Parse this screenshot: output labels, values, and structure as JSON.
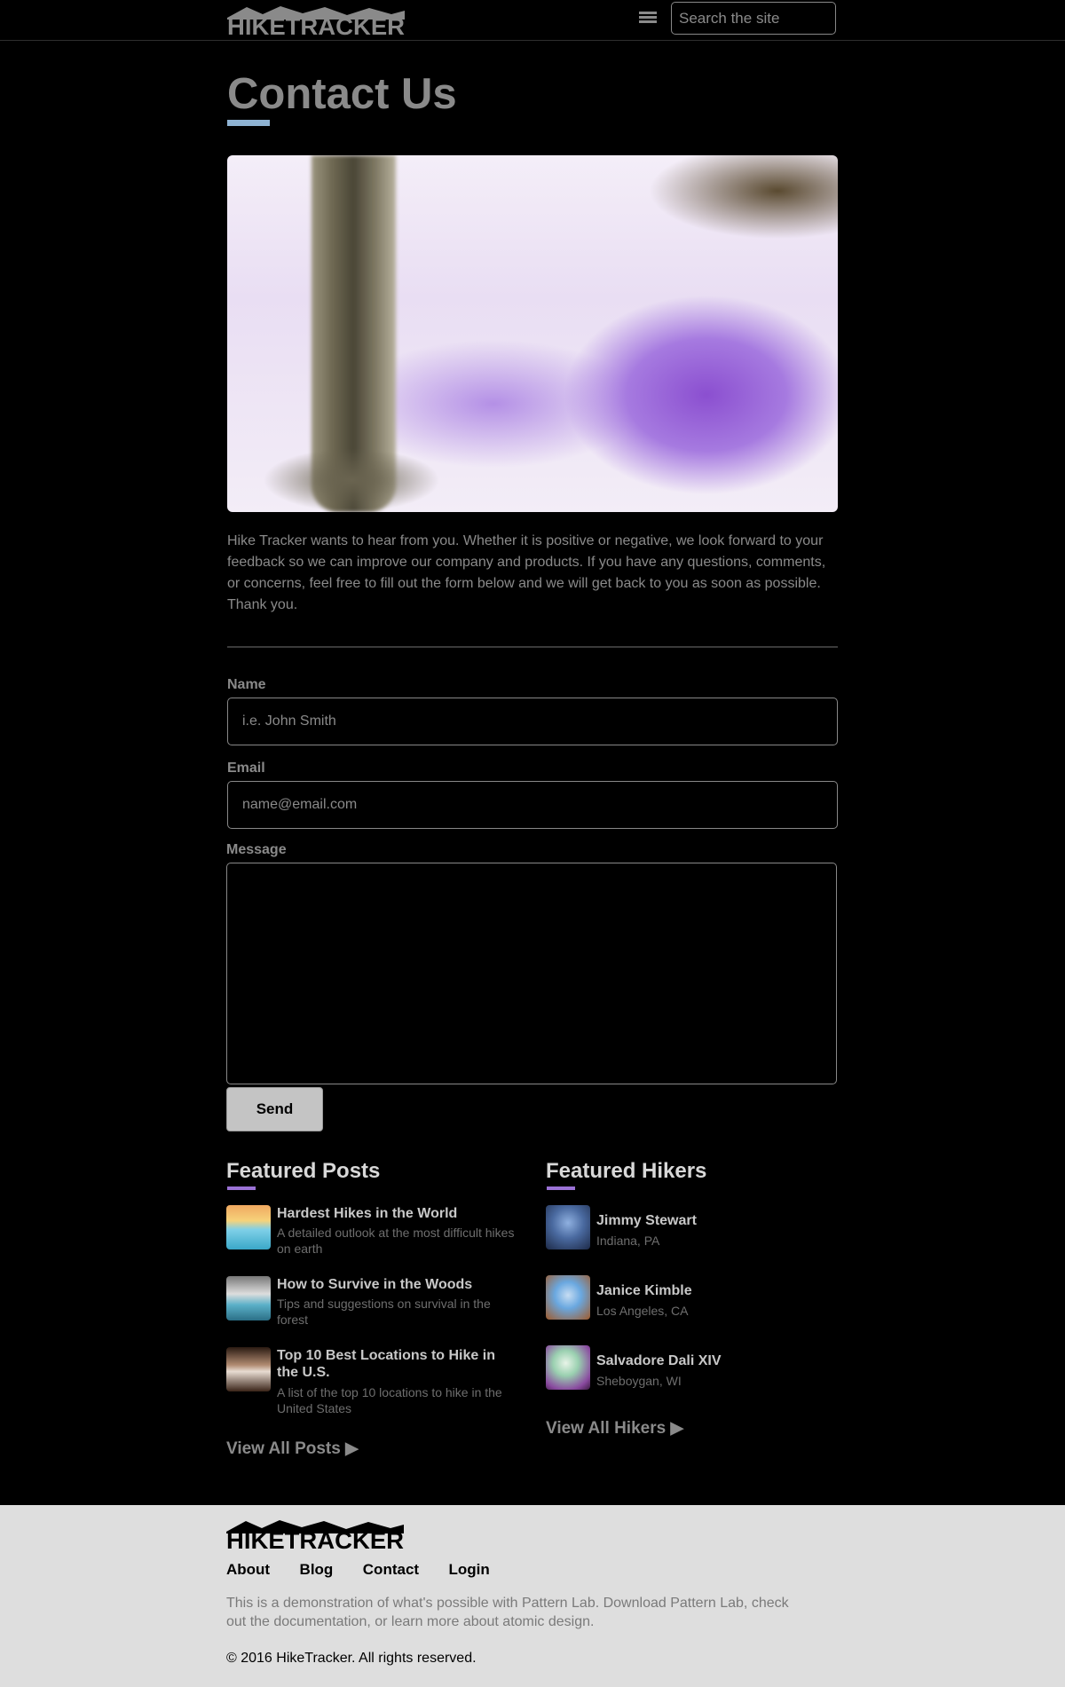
{
  "header": {
    "logo_text": "HIKETRACKER",
    "search_placeholder": "Search the site"
  },
  "page": {
    "title": "Contact Us",
    "intro": "Hike Tracker wants to hear from you. Whether it is positive or negative, we look forward to your feedback so we can improve our company and products. If you have any questions, comments, or concerns, feel free to fill out the form below and we will get back to you as soon as possible. Thank you."
  },
  "form": {
    "name_label": "Name",
    "name_placeholder": "i.e. John Smith",
    "email_label": "Email",
    "email_placeholder": "name@email.com",
    "message_label": "Message",
    "send_label": "Send"
  },
  "featured_posts": {
    "title": "Featured Posts",
    "items": [
      {
        "title": "Hardest Hikes in the World",
        "excerpt": "A detailed outlook at the most difficult hikes on earth"
      },
      {
        "title": "How to Survive in the Woods",
        "excerpt": "Tips and suggestions on survival in the forest"
      },
      {
        "title": "Top 10 Best Locations to Hike in the U.S.",
        "excerpt": "A list of the top 10 locations to hike in the United States"
      }
    ],
    "view_all": "View All Posts ▶"
  },
  "featured_hikers": {
    "title": "Featured Hikers",
    "items": [
      {
        "name": "Jimmy Stewart",
        "location": "Indiana, PA"
      },
      {
        "name": "Janice Kimble",
        "location": "Los Angeles, CA"
      },
      {
        "name": "Salvadore Dali XIV",
        "location": "Sheboygan, WI"
      }
    ],
    "view_all": "View All Hikers ▶"
  },
  "footer": {
    "logo_text": "HIKETRACKER",
    "nav": [
      "About",
      "Blog",
      "Contact",
      "Login"
    ],
    "description": "This is a demonstration of what's possible with Pattern Lab. Download Pattern Lab, check out the documentation, or learn more about atomic design.",
    "copyright": "© 2016 HikeTracker. All rights reserved."
  },
  "colors": {
    "background": "#000000",
    "text": "#8a8a8a",
    "title_accent": "#8fb3d3",
    "section_accent": "#9b72d6",
    "footer_bg": "#dedede"
  }
}
